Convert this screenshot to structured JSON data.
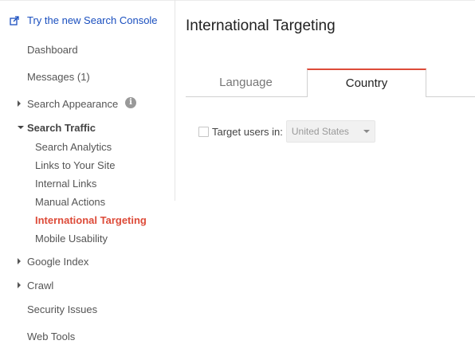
{
  "promo": {
    "label": "Try the new Search Console",
    "icon": "external-link-icon"
  },
  "sidebar": {
    "dashboard": "Dashboard",
    "messages": "Messages (1)",
    "search_appearance": "Search Appearance",
    "search_traffic": "Search Traffic",
    "search_traffic_items": [
      "Search Analytics",
      "Links to Your Site",
      "Internal Links",
      "Manual Actions",
      "International Targeting",
      "Mobile Usability"
    ],
    "active_item": "International Targeting",
    "google_index": "Google Index",
    "crawl": "Crawl",
    "security_issues": "Security Issues",
    "web_tools": "Web Tools",
    "info_icon_glyph": "i"
  },
  "main": {
    "title": "International Targeting",
    "tabs": [
      {
        "label": "Language",
        "selected": false
      },
      {
        "label": "Country",
        "selected": true
      }
    ],
    "target_label": "Target users in:",
    "country_select_value": "United States",
    "checkbox_checked": false
  },
  "colors": {
    "accent_red": "#dd4b39",
    "link_blue": "#1a4fbf",
    "nav_text": "#555555"
  }
}
